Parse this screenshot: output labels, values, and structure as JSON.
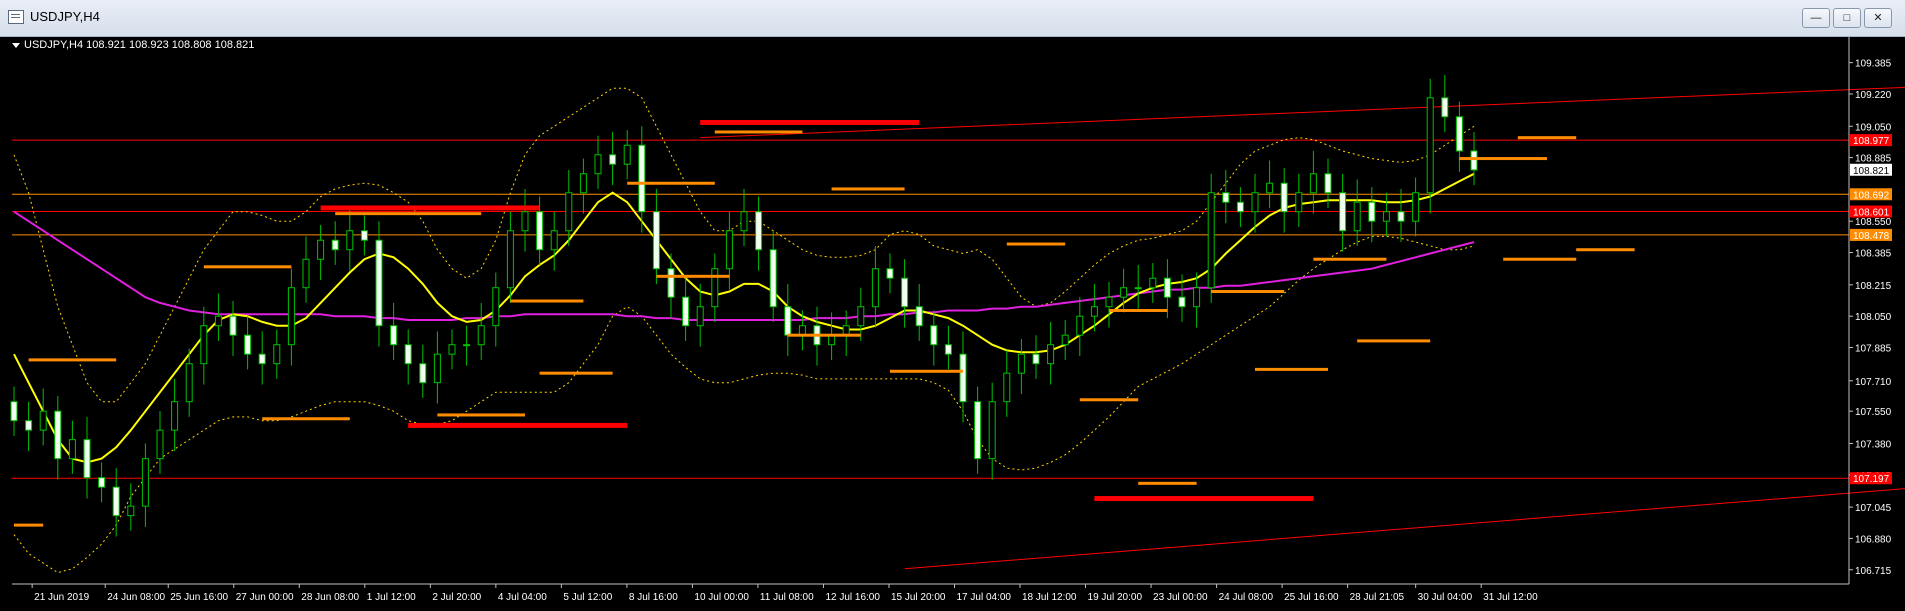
{
  "window": {
    "title": "USDJPY,H4"
  },
  "chart_data": {
    "type": "candlestick",
    "symbol": "USDJPY,H4",
    "header": "USDJPY,H4  108.921 108.923 108.808 108.821",
    "price_axis": {
      "ylim": [
        106.64,
        109.52
      ],
      "ticks": [
        "109.385",
        "109.220",
        "109.050",
        "108.885",
        "108.550",
        "108.385",
        "108.215",
        "108.050",
        "107.885",
        "107.710",
        "107.550",
        "107.380",
        "107.215",
        "107.045",
        "106.880",
        "106.715"
      ],
      "tick_values": [
        109.385,
        109.22,
        109.05,
        108.885,
        108.55,
        108.385,
        108.215,
        108.05,
        107.885,
        107.71,
        107.55,
        107.38,
        107.215,
        107.045,
        106.88,
        106.715
      ]
    },
    "time_axis": {
      "labels": [
        "21 Jun 2019",
        "24 Jun 08:00",
        "25 Jun 16:00",
        "27 Jun 00:00",
        "28 Jun 08:00",
        "1 Jul 12:00",
        "2 Jul 20:00",
        "4 Jul 04:00",
        "5 Jul 12:00",
        "8 Jul 16:00",
        "10 Jul 00:00",
        "11 Jul 08:00",
        "12 Jul 16:00",
        "15 Jul 20:00",
        "17 Jul 04:00",
        "18 Jul 12:00",
        "19 Jul 20:00",
        "23 Jul 00:00",
        "24 Jul 08:00",
        "25 Jul 16:00",
        "28 Jul 21:05",
        "30 Jul 04:00",
        "31 Jul 12:00"
      ]
    },
    "current_price": {
      "label": "108.821",
      "value": 108.821
    },
    "price_tags": [
      {
        "label": "108.977",
        "value": 108.977,
        "color": "#ff0000"
      },
      {
        "label": "108.692",
        "value": 108.692,
        "color": "#ff8c00"
      },
      {
        "label": "108.601",
        "value": 108.601,
        "color": "#ff0000"
      },
      {
        "label": "108.478",
        "value": 108.478,
        "color": "#ff8c00"
      },
      {
        "label": "107.197",
        "value": 107.197,
        "color": "#ff0000"
      }
    ],
    "horizontal_lines": [
      {
        "value": 108.977,
        "color": "#ff0000"
      },
      {
        "value": 108.692,
        "color": "#ff8c00"
      },
      {
        "value": 108.601,
        "color": "#ff0000"
      },
      {
        "value": 108.478,
        "color": "#ff8c00"
      },
      {
        "value": 107.197,
        "color": "#ff0000"
      }
    ],
    "trend_lines": [
      {
        "from": [
          61,
          106.72
        ],
        "to": [
          212,
          107.65
        ],
        "color": "#ff0000"
      },
      {
        "from": [
          47,
          108.99
        ],
        "to": [
          212,
          109.52
        ],
        "color": "#ff0000"
      }
    ],
    "marker_bars": [
      {
        "bar": 1,
        "value": 107.82,
        "length": 6,
        "color": "#ff8c00"
      },
      {
        "bar": 0,
        "value": 106.95,
        "length": 2,
        "color": "#ff8c00"
      },
      {
        "bar": 13,
        "value": 108.31,
        "length": 6,
        "color": "#ff8c00"
      },
      {
        "bar": 17,
        "value": 107.51,
        "length": 6,
        "color": "#ff8c00"
      },
      {
        "bar": 21,
        "value": 108.62,
        "length": 15,
        "color": "#ff0000",
        "thick": true
      },
      {
        "bar": 22,
        "value": 108.59,
        "length": 10,
        "color": "#ff8c00"
      },
      {
        "bar": 27,
        "value": 107.475,
        "length": 15,
        "color": "#ff0000",
        "thick": true
      },
      {
        "bar": 29,
        "value": 107.53,
        "length": 6,
        "color": "#ff8c00"
      },
      {
        "bar": 34,
        "value": 108.13,
        "length": 5,
        "color": "#ff8c00"
      },
      {
        "bar": 36,
        "value": 107.75,
        "length": 5,
        "color": "#ff8c00"
      },
      {
        "bar": 42,
        "value": 108.75,
        "length": 6,
        "color": "#ff8c00"
      },
      {
        "bar": 44,
        "value": 108.26,
        "length": 5,
        "color": "#ff8c00"
      },
      {
        "bar": 47,
        "value": 109.07,
        "length": 15,
        "color": "#ff0000",
        "thick": true
      },
      {
        "bar": 48,
        "value": 109.02,
        "length": 6,
        "color": "#ff8c00"
      },
      {
        "bar": 53,
        "value": 107.95,
        "length": 5,
        "color": "#ff8c00"
      },
      {
        "bar": 56,
        "value": 108.72,
        "length": 5,
        "color": "#ff8c00"
      },
      {
        "bar": 60,
        "value": 107.76,
        "length": 5,
        "color": "#ff8c00"
      },
      {
        "bar": 68,
        "value": 108.43,
        "length": 4,
        "color": "#ff8c00"
      },
      {
        "bar": 73,
        "value": 107.61,
        "length": 4,
        "color": "#ff8c00"
      },
      {
        "bar": 75,
        "value": 108.08,
        "length": 4,
        "color": "#ff8c00"
      },
      {
        "bar": 77,
        "value": 107.17,
        "length": 4,
        "color": "#ff8c00"
      },
      {
        "bar": 74,
        "value": 107.09,
        "length": 15,
        "color": "#ff0000",
        "thick": true
      },
      {
        "bar": 82,
        "value": 108.18,
        "length": 5,
        "color": "#ff8c00"
      },
      {
        "bar": 85,
        "value": 107.77,
        "length": 5,
        "color": "#ff8c00"
      },
      {
        "bar": 89,
        "value": 108.35,
        "length": 5,
        "color": "#ff8c00"
      },
      {
        "bar": 92,
        "value": 107.92,
        "length": 5,
        "color": "#ff8c00"
      },
      {
        "bar": 99,
        "value": 108.88,
        "length": 6,
        "color": "#ff8c00"
      },
      {
        "bar": 102,
        "value": 108.35,
        "length": 5,
        "color": "#ff8c00"
      },
      {
        "bar": 103,
        "value": 108.99,
        "length": 4,
        "color": "#ff8c00"
      },
      {
        "bar": 107,
        "value": 108.4,
        "length": 4,
        "color": "#ff8c00"
      }
    ],
    "candles": {
      "open": [
        107.6,
        107.5,
        107.45,
        107.55,
        107.3,
        107.4,
        107.2,
        107.15,
        107.0,
        107.05,
        107.3,
        107.45,
        107.6,
        107.8,
        108.0,
        108.05,
        107.95,
        107.85,
        107.8,
        107.9,
        108.2,
        108.35,
        108.45,
        108.4,
        108.5,
        108.45,
        108.0,
        107.9,
        107.8,
        107.7,
        107.85,
        107.9,
        107.9,
        108.0,
        108.2,
        108.5,
        108.6,
        108.4,
        108.5,
        108.7,
        108.8,
        108.9,
        108.85,
        108.95,
        108.6,
        108.3,
        108.15,
        108.0,
        108.1,
        108.3,
        108.5,
        108.6,
        108.4,
        108.1,
        107.95,
        108.0,
        107.9,
        107.95,
        108.0,
        108.1,
        108.3,
        108.25,
        108.1,
        108.0,
        107.9,
        107.85,
        107.6,
        107.3,
        107.6,
        107.75,
        107.85,
        107.8,
        107.9,
        107.95,
        108.05,
        108.1,
        108.15,
        108.2,
        108.2,
        108.25,
        108.15,
        108.1,
        108.2,
        108.7,
        108.65,
        108.6,
        108.7,
        108.75,
        108.6,
        108.7,
        108.8,
        108.7,
        108.5,
        108.65,
        108.55,
        108.6,
        108.55,
        108.7,
        109.2,
        109.1,
        108.92
      ],
      "close": [
        107.5,
        107.45,
        107.55,
        107.3,
        107.4,
        107.2,
        107.15,
        107.0,
        107.05,
        107.3,
        107.45,
        107.6,
        107.8,
        108.0,
        108.05,
        107.95,
        107.85,
        107.8,
        107.9,
        108.2,
        108.35,
        108.45,
        108.4,
        108.5,
        108.45,
        108.0,
        107.9,
        107.8,
        107.7,
        107.85,
        107.9,
        107.9,
        108.0,
        108.2,
        108.5,
        108.6,
        108.4,
        108.5,
        108.7,
        108.8,
        108.9,
        108.85,
        108.95,
        108.6,
        108.3,
        108.15,
        108.0,
        108.1,
        108.3,
        108.5,
        108.6,
        108.4,
        108.1,
        107.95,
        108.0,
        107.9,
        107.95,
        108.0,
        108.1,
        108.3,
        108.25,
        108.1,
        108.0,
        107.9,
        107.85,
        107.6,
        107.3,
        107.6,
        107.75,
        107.85,
        107.8,
        107.9,
        107.95,
        108.05,
        108.1,
        108.15,
        108.2,
        108.2,
        108.25,
        108.15,
        108.1,
        108.2,
        108.7,
        108.65,
        108.6,
        108.7,
        108.75,
        108.6,
        108.7,
        108.8,
        108.7,
        108.5,
        108.65,
        108.55,
        108.6,
        108.55,
        108.7,
        109.2,
        109.1,
        108.92,
        108.82
      ]
    },
    "ma_yellow": [
      107.85,
      107.7,
      107.55,
      107.4,
      107.3,
      107.28,
      107.3,
      107.36,
      107.45,
      107.55,
      107.65,
      107.75,
      107.85,
      107.95,
      108.03,
      108.06,
      108.05,
      108.02,
      108.0,
      108.0,
      108.04,
      108.12,
      108.2,
      108.28,
      108.35,
      108.38,
      108.36,
      108.3,
      108.22,
      108.12,
      108.05,
      108.02,
      108.03,
      108.08,
      108.16,
      108.26,
      108.32,
      108.37,
      108.45,
      108.55,
      108.65,
      108.7,
      108.65,
      108.55,
      108.45,
      108.35,
      108.25,
      108.18,
      108.16,
      108.18,
      108.22,
      108.22,
      108.18,
      108.1,
      108.05,
      108.02,
      108.0,
      107.98,
      107.98,
      108.0,
      108.04,
      108.08,
      108.08,
      108.06,
      108.04,
      108.0,
      107.95,
      107.9,
      107.87,
      107.86,
      107.86,
      107.87,
      107.9,
      107.95,
      108.0,
      108.06,
      108.12,
      108.17,
      108.2,
      108.22,
      108.23,
      108.25,
      108.3,
      108.38,
      108.45,
      108.52,
      108.58,
      108.62,
      108.64,
      108.65,
      108.66,
      108.66,
      108.66,
      108.66,
      108.65,
      108.65,
      108.66,
      108.68,
      108.72,
      108.76,
      108.8
    ],
    "ma_magenta": [
      108.6,
      108.55,
      108.5,
      108.45,
      108.4,
      108.35,
      108.3,
      108.25,
      108.2,
      108.15,
      108.12,
      108.1,
      108.08,
      108.07,
      108.06,
      108.06,
      108.06,
      108.06,
      108.06,
      108.06,
      108.06,
      108.06,
      108.05,
      108.05,
      108.05,
      108.04,
      108.04,
      108.03,
      108.03,
      108.03,
      108.03,
      108.04,
      108.04,
      108.05,
      108.05,
      108.06,
      108.06,
      108.06,
      108.06,
      108.06,
      108.06,
      108.06,
      108.05,
      108.05,
      108.04,
      108.04,
      108.03,
      108.03,
      108.03,
      108.03,
      108.03,
      108.03,
      108.03,
      108.03,
      108.03,
      108.04,
      108.04,
      108.04,
      108.05,
      108.05,
      108.06,
      108.06,
      108.07,
      108.07,
      108.08,
      108.08,
      108.08,
      108.09,
      108.09,
      108.1,
      108.1,
      108.11,
      108.12,
      108.13,
      108.14,
      108.15,
      108.16,
      108.17,
      108.18,
      108.19,
      108.19,
      108.2,
      108.2,
      108.21,
      108.21,
      108.22,
      108.23,
      108.24,
      108.25,
      108.26,
      108.27,
      108.28,
      108.29,
      108.3,
      108.32,
      108.34,
      108.36,
      108.38,
      108.4,
      108.42,
      108.44
    ],
    "bb_upper": [
      108.9,
      108.7,
      108.4,
      108.1,
      107.9,
      107.7,
      107.6,
      107.6,
      107.7,
      107.8,
      107.95,
      108.1,
      108.25,
      108.4,
      108.5,
      108.6,
      108.6,
      108.58,
      108.55,
      108.55,
      108.6,
      108.68,
      108.72,
      108.74,
      108.75,
      108.74,
      108.7,
      108.65,
      108.55,
      108.4,
      108.3,
      108.25,
      108.3,
      108.45,
      108.7,
      108.9,
      109.0,
      109.05,
      109.1,
      109.15,
      109.2,
      109.25,
      109.25,
      109.2,
      109.05,
      108.9,
      108.75,
      108.6,
      108.5,
      108.5,
      108.55,
      108.55,
      108.5,
      108.45,
      108.4,
      108.37,
      108.36,
      108.36,
      108.37,
      108.4,
      108.48,
      108.5,
      108.48,
      108.42,
      108.4,
      108.38,
      108.4,
      108.35,
      108.25,
      108.15,
      108.1,
      108.12,
      108.18,
      108.25,
      108.32,
      108.38,
      108.42,
      108.45,
      108.46,
      108.48,
      108.5,
      108.55,
      108.65,
      108.75,
      108.85,
      108.92,
      108.95,
      108.98,
      108.99,
      108.98,
      108.95,
      108.92,
      108.9,
      108.88,
      108.87,
      108.86,
      108.87,
      108.9,
      108.95,
      109.0,
      109.05
    ],
    "bb_lower": [
      106.9,
      106.8,
      106.75,
      106.7,
      106.72,
      106.78,
      106.85,
      106.95,
      107.1,
      107.2,
      107.3,
      107.35,
      107.4,
      107.45,
      107.5,
      107.52,
      107.52,
      107.5,
      107.5,
      107.52,
      107.55,
      107.58,
      107.6,
      107.6,
      107.6,
      107.58,
      107.55,
      107.5,
      107.48,
      107.48,
      107.5,
      107.55,
      107.6,
      107.65,
      107.65,
      107.65,
      107.65,
      107.65,
      107.7,
      107.8,
      107.9,
      108.05,
      108.1,
      108.05,
      107.95,
      107.85,
      107.78,
      107.72,
      107.7,
      107.7,
      107.72,
      107.74,
      107.75,
      107.75,
      107.74,
      107.72,
      107.72,
      107.72,
      107.72,
      107.72,
      107.72,
      107.72,
      107.72,
      107.7,
      107.66,
      107.55,
      107.4,
      107.3,
      107.25,
      107.24,
      107.25,
      107.28,
      107.32,
      107.38,
      107.45,
      107.52,
      107.6,
      107.68,
      107.72,
      107.76,
      107.8,
      107.85,
      107.9,
      107.95,
      108.0,
      108.05,
      108.1,
      108.17,
      108.24,
      108.3,
      108.35,
      108.4,
      108.44,
      108.47,
      108.47,
      108.46,
      108.44,
      108.42,
      108.4,
      108.4,
      108.42
    ]
  }
}
